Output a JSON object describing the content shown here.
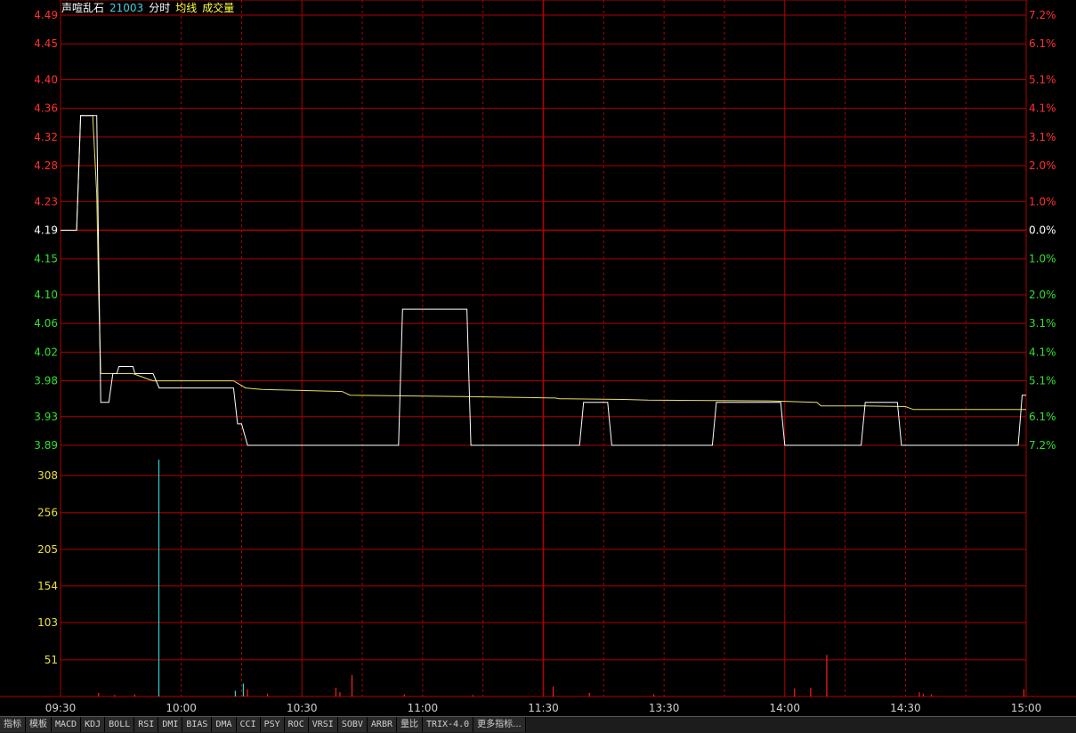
{
  "header": {
    "stock_name": "声喧乱石",
    "stock_code": "21003",
    "label_minute": "分时",
    "label_avg": "均线",
    "label_volume": "成交量"
  },
  "colors": {
    "background": "#000000",
    "grid": "#b00000",
    "price_line": "#ffffff",
    "avg_line": "#e8e060",
    "up": "#ff3030",
    "down": "#30e030",
    "neutral": "#ffffff",
    "volume_axis": "#e8e040",
    "volume_up": "#ff2020",
    "volume_down": "#30d0d0",
    "time_label": "#d0d0d0"
  },
  "chart_data": {
    "type": "line",
    "prev_close": 4.19,
    "price_ticks": [
      "4.49",
      "4.45",
      "4.40",
      "4.36",
      "4.32",
      "4.28",
      "4.23",
      "4.19",
      "4.15",
      "4.10",
      "4.06",
      "4.02",
      "3.98",
      "3.93",
      "3.89"
    ],
    "price_tick_values": [
      4.49,
      4.45,
      4.4,
      4.36,
      4.32,
      4.28,
      4.23,
      4.19,
      4.15,
      4.1,
      4.06,
      4.02,
      3.98,
      3.93,
      3.89
    ],
    "pct_ticks": [
      "7.2%",
      "6.1%",
      "5.1%",
      "4.1%",
      "3.1%",
      "2.0%",
      "1.0%",
      "0.0%",
      "1.0%",
      "2.0%",
      "3.1%",
      "4.1%",
      "5.1%",
      "6.1%",
      "7.2%"
    ],
    "volume_ticks": [
      "308",
      "256",
      "205",
      "154",
      "103",
      "51"
    ],
    "volume_tick_values": [
      308,
      256,
      205,
      154,
      103,
      51
    ],
    "volume_max": 350,
    "time_labels": [
      "09:30",
      "10:00",
      "10:30",
      "11:00",
      "11:30",
      "13:30",
      "14:00",
      "14:30",
      "15:00"
    ],
    "total_minutes": 240,
    "price_series": [
      [
        0,
        4.19
      ],
      [
        4,
        4.19
      ],
      [
        5,
        4.35
      ],
      [
        8,
        4.35
      ],
      [
        9,
        4.35
      ],
      [
        9.5,
        4.15
      ],
      [
        10,
        3.95
      ],
      [
        12,
        3.95
      ],
      [
        13,
        3.99
      ],
      [
        14,
        3.99
      ],
      [
        14.5,
        4.0
      ],
      [
        18,
        4.0
      ],
      [
        18.5,
        3.99
      ],
      [
        23,
        3.99
      ],
      [
        24.5,
        3.97
      ],
      [
        43,
        3.97
      ],
      [
        44,
        3.92
      ],
      [
        45,
        3.92
      ],
      [
        46.5,
        3.89
      ],
      [
        84,
        3.89
      ],
      [
        85,
        4.08
      ],
      [
        101,
        4.08
      ],
      [
        102,
        3.89
      ],
      [
        129,
        3.89
      ],
      [
        130,
        3.95
      ],
      [
        136,
        3.95
      ],
      [
        137,
        3.89
      ],
      [
        162,
        3.89
      ],
      [
        163,
        3.95
      ],
      [
        179,
        3.95
      ],
      [
        180,
        3.89
      ],
      [
        199,
        3.89
      ],
      [
        200,
        3.95
      ],
      [
        208,
        3.95
      ],
      [
        209,
        3.89
      ],
      [
        238,
        3.89
      ],
      [
        239,
        3.96
      ],
      [
        240,
        3.96
      ]
    ],
    "avg_series": [
      [
        0,
        4.19
      ],
      [
        4,
        4.19
      ],
      [
        5,
        4.35
      ],
      [
        8,
        4.35
      ],
      [
        9,
        4.24
      ],
      [
        9.5,
        4.1
      ],
      [
        10,
        3.99
      ],
      [
        12,
        3.99
      ],
      [
        13,
        3.99
      ],
      [
        18,
        3.99
      ],
      [
        23,
        3.98
      ],
      [
        24,
        3.98
      ],
      [
        43,
        3.98
      ],
      [
        46,
        3.97
      ],
      [
        50,
        3.968
      ],
      [
        70,
        3.965
      ],
      [
        72,
        3.96
      ],
      [
        100,
        3.958
      ],
      [
        123,
        3.956
      ],
      [
        124,
        3.955
      ],
      [
        140,
        3.954
      ],
      [
        146,
        3.953
      ],
      [
        176,
        3.952
      ],
      [
        188,
        3.95
      ],
      [
        189,
        3.945
      ],
      [
        200,
        3.945
      ],
      [
        210,
        3.944
      ],
      [
        212,
        3.94
      ],
      [
        240,
        3.94
      ]
    ],
    "volume_bars": [
      {
        "m": 9,
        "v": 5,
        "up": true
      },
      {
        "m": 13,
        "v": 2,
        "up": true
      },
      {
        "m": 18,
        "v": 3,
        "up": true
      },
      {
        "m": 24,
        "v": 330,
        "up": false
      },
      {
        "m": 43,
        "v": 8,
        "up": false
      },
      {
        "m": 45,
        "v": 18,
        "up": false
      },
      {
        "m": 46,
        "v": 10,
        "up": true
      },
      {
        "m": 51,
        "v": 4,
        "up": true
      },
      {
        "m": 68,
        "v": 12,
        "up": true
      },
      {
        "m": 69,
        "v": 6,
        "up": true
      },
      {
        "m": 72,
        "v": 30,
        "up": true
      },
      {
        "m": 85,
        "v": 3,
        "up": true
      },
      {
        "m": 102,
        "v": 2,
        "up": true
      },
      {
        "m": 122,
        "v": 14,
        "up": true
      },
      {
        "m": 131,
        "v": 5,
        "up": true
      },
      {
        "m": 147,
        "v": 3,
        "up": true
      },
      {
        "m": 182,
        "v": 11,
        "up": true
      },
      {
        "m": 186,
        "v": 12,
        "up": true
      },
      {
        "m": 190,
        "v": 58,
        "up": true
      },
      {
        "m": 213,
        "v": 6,
        "up": true
      },
      {
        "m": 214,
        "v": 4,
        "up": true
      },
      {
        "m": 216,
        "v": 3,
        "up": true
      },
      {
        "m": 239,
        "v": 10,
        "up": true
      }
    ]
  },
  "tabs": [
    "指标",
    "模板",
    "MACD",
    "KDJ",
    "BOLL",
    "RSI",
    "DMI",
    "BIAS",
    "DMA",
    "CCI",
    "PSY",
    "ROC",
    "VRSI",
    "SOBV",
    "ARBR",
    "量比",
    "TRIX-4.0",
    "更多指标..."
  ]
}
